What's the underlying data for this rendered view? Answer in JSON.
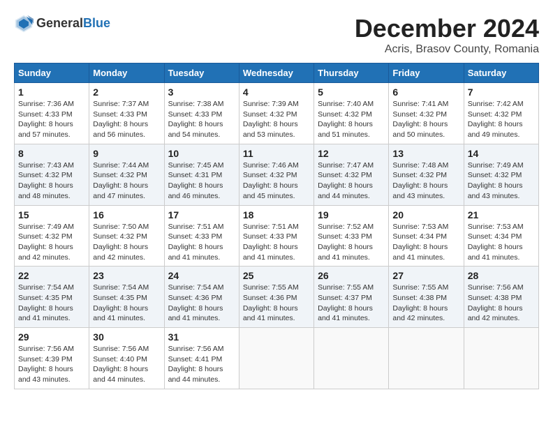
{
  "header": {
    "logo_general": "General",
    "logo_blue": "Blue",
    "month_title": "December 2024",
    "location": "Acris, Brasov County, Romania"
  },
  "calendar": {
    "days_of_week": [
      "Sunday",
      "Monday",
      "Tuesday",
      "Wednesday",
      "Thursday",
      "Friday",
      "Saturday"
    ],
    "weeks": [
      [
        {
          "day": "1",
          "sunrise": "7:36 AM",
          "sunset": "4:33 PM",
          "daylight": "8 hours and 57 minutes."
        },
        {
          "day": "2",
          "sunrise": "7:37 AM",
          "sunset": "4:33 PM",
          "daylight": "8 hours and 56 minutes."
        },
        {
          "day": "3",
          "sunrise": "7:38 AM",
          "sunset": "4:33 PM",
          "daylight": "8 hours and 54 minutes."
        },
        {
          "day": "4",
          "sunrise": "7:39 AM",
          "sunset": "4:32 PM",
          "daylight": "8 hours and 53 minutes."
        },
        {
          "day": "5",
          "sunrise": "7:40 AM",
          "sunset": "4:32 PM",
          "daylight": "8 hours and 51 minutes."
        },
        {
          "day": "6",
          "sunrise": "7:41 AM",
          "sunset": "4:32 PM",
          "daylight": "8 hours and 50 minutes."
        },
        {
          "day": "7",
          "sunrise": "7:42 AM",
          "sunset": "4:32 PM",
          "daylight": "8 hours and 49 minutes."
        }
      ],
      [
        {
          "day": "8",
          "sunrise": "7:43 AM",
          "sunset": "4:32 PM",
          "daylight": "8 hours and 48 minutes."
        },
        {
          "day": "9",
          "sunrise": "7:44 AM",
          "sunset": "4:32 PM",
          "daylight": "8 hours and 47 minutes."
        },
        {
          "day": "10",
          "sunrise": "7:45 AM",
          "sunset": "4:31 PM",
          "daylight": "8 hours and 46 minutes."
        },
        {
          "day": "11",
          "sunrise": "7:46 AM",
          "sunset": "4:32 PM",
          "daylight": "8 hours and 45 minutes."
        },
        {
          "day": "12",
          "sunrise": "7:47 AM",
          "sunset": "4:32 PM",
          "daylight": "8 hours and 44 minutes."
        },
        {
          "day": "13",
          "sunrise": "7:48 AM",
          "sunset": "4:32 PM",
          "daylight": "8 hours and 43 minutes."
        },
        {
          "day": "14",
          "sunrise": "7:49 AM",
          "sunset": "4:32 PM",
          "daylight": "8 hours and 43 minutes."
        }
      ],
      [
        {
          "day": "15",
          "sunrise": "7:49 AM",
          "sunset": "4:32 PM",
          "daylight": "8 hours and 42 minutes."
        },
        {
          "day": "16",
          "sunrise": "7:50 AM",
          "sunset": "4:32 PM",
          "daylight": "8 hours and 42 minutes."
        },
        {
          "day": "17",
          "sunrise": "7:51 AM",
          "sunset": "4:33 PM",
          "daylight": "8 hours and 41 minutes."
        },
        {
          "day": "18",
          "sunrise": "7:51 AM",
          "sunset": "4:33 PM",
          "daylight": "8 hours and 41 minutes."
        },
        {
          "day": "19",
          "sunrise": "7:52 AM",
          "sunset": "4:33 PM",
          "daylight": "8 hours and 41 minutes."
        },
        {
          "day": "20",
          "sunrise": "7:53 AM",
          "sunset": "4:34 PM",
          "daylight": "8 hours and 41 minutes."
        },
        {
          "day": "21",
          "sunrise": "7:53 AM",
          "sunset": "4:34 PM",
          "daylight": "8 hours and 41 minutes."
        }
      ],
      [
        {
          "day": "22",
          "sunrise": "7:54 AM",
          "sunset": "4:35 PM",
          "daylight": "8 hours and 41 minutes."
        },
        {
          "day": "23",
          "sunrise": "7:54 AM",
          "sunset": "4:35 PM",
          "daylight": "8 hours and 41 minutes."
        },
        {
          "day": "24",
          "sunrise": "7:54 AM",
          "sunset": "4:36 PM",
          "daylight": "8 hours and 41 minutes."
        },
        {
          "day": "25",
          "sunrise": "7:55 AM",
          "sunset": "4:36 PM",
          "daylight": "8 hours and 41 minutes."
        },
        {
          "day": "26",
          "sunrise": "7:55 AM",
          "sunset": "4:37 PM",
          "daylight": "8 hours and 41 minutes."
        },
        {
          "day": "27",
          "sunrise": "7:55 AM",
          "sunset": "4:38 PM",
          "daylight": "8 hours and 42 minutes."
        },
        {
          "day": "28",
          "sunrise": "7:56 AM",
          "sunset": "4:38 PM",
          "daylight": "8 hours and 42 minutes."
        }
      ],
      [
        {
          "day": "29",
          "sunrise": "7:56 AM",
          "sunset": "4:39 PM",
          "daylight": "8 hours and 43 minutes."
        },
        {
          "day": "30",
          "sunrise": "7:56 AM",
          "sunset": "4:40 PM",
          "daylight": "8 hours and 44 minutes."
        },
        {
          "day": "31",
          "sunrise": "7:56 AM",
          "sunset": "4:41 PM",
          "daylight": "8 hours and 44 minutes."
        },
        null,
        null,
        null,
        null
      ]
    ],
    "labels": {
      "sunrise": "Sunrise:",
      "sunset": "Sunset:",
      "daylight": "Daylight:"
    }
  }
}
